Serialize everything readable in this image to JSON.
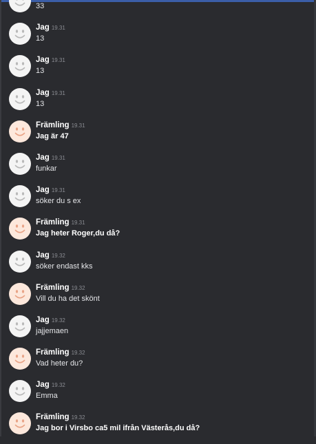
{
  "colors": {
    "background": "#2a2b2f",
    "avatar_jag": "#f4f4f4",
    "avatar_framling": "#fde8dc",
    "face_jag": "#b9b9b9",
    "face_framling": "#e9a487",
    "accent_top": "#3b5ea8"
  },
  "messages": [
    {
      "sender": "",
      "time": "",
      "text": "33",
      "bold": false,
      "avatar": "jag",
      "icon": "smiley-face-icon"
    },
    {
      "sender": "Jag",
      "time": "19.31",
      "text": "13",
      "bold": false,
      "avatar": "jag",
      "icon": "smiley-face-icon"
    },
    {
      "sender": "Jag",
      "time": "19.31",
      "text": "13",
      "bold": false,
      "avatar": "jag",
      "icon": "smiley-face-icon"
    },
    {
      "sender": "Jag",
      "time": "19.31",
      "text": "13",
      "bold": false,
      "avatar": "jag",
      "icon": "smiley-face-icon"
    },
    {
      "sender": "Främling",
      "time": "19.31",
      "text": "Jag är 47",
      "bold": true,
      "avatar": "framling",
      "icon": "smiley-face-icon"
    },
    {
      "sender": "Jag",
      "time": "19.31",
      "text": "funkar",
      "bold": false,
      "avatar": "jag",
      "icon": "smiley-face-icon"
    },
    {
      "sender": "Jag",
      "time": "19.31",
      "text": "söker du s ex",
      "bold": false,
      "avatar": "jag",
      "icon": "smiley-face-icon"
    },
    {
      "sender": "Främling",
      "time": "19.31",
      "text": "Jag heter Roger,du då?",
      "bold": true,
      "avatar": "framling",
      "icon": "smiley-face-icon"
    },
    {
      "sender": "Jag",
      "time": "19.32",
      "text": "söker endast kks",
      "bold": false,
      "avatar": "jag",
      "icon": "smiley-face-icon"
    },
    {
      "sender": "Främling",
      "time": "19.32",
      "text": "Vill du ha det skönt",
      "bold": false,
      "avatar": "framling",
      "icon": "smiley-face-icon"
    },
    {
      "sender": "Jag",
      "time": "19.32",
      "text": "jajjemaen",
      "bold": false,
      "avatar": "jag",
      "icon": "smiley-face-icon"
    },
    {
      "sender": "Främling",
      "time": "19.32",
      "text": "Vad heter du?",
      "bold": false,
      "avatar": "framling",
      "icon": "smiley-face-icon"
    },
    {
      "sender": "Jag",
      "time": "19.32",
      "text": "Emma",
      "bold": false,
      "avatar": "jag",
      "icon": "smiley-face-icon"
    },
    {
      "sender": "Främling",
      "time": "19.32",
      "text": "Jag bor i Virsbo ca5 mil ifrån Västerås,du då?",
      "bold": true,
      "avatar": "framling",
      "icon": "smiley-face-icon"
    }
  ]
}
